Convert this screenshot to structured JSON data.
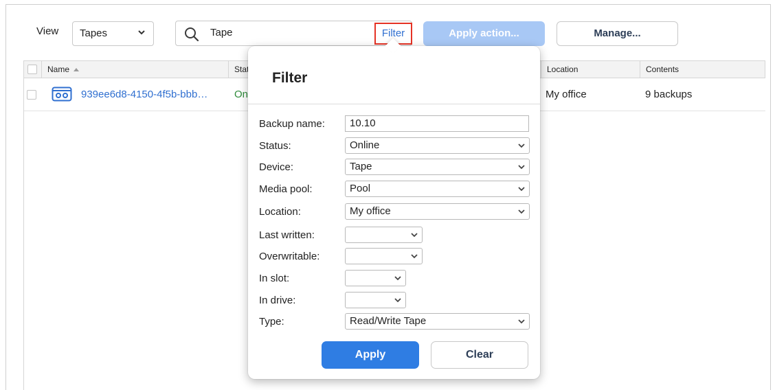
{
  "toolbar": {
    "view_label": "View",
    "view_value": "Tapes",
    "search_value": "Tape",
    "clear_glyph": "×",
    "filter_label": "Filter",
    "apply_action_label": "Apply action...",
    "manage_label": "Manage..."
  },
  "table": {
    "columns": [
      "Name",
      "Stat",
      "Location",
      "Contents"
    ],
    "rows": [
      {
        "name": "939ee6d8-4150-4f5b-bbb…",
        "status": "On",
        "location": "My office",
        "contents": "9 backups"
      }
    ]
  },
  "filter": {
    "title": "Filter",
    "fields": [
      {
        "label": "Backup name:",
        "value": "10.10"
      },
      {
        "label": "Status:",
        "value": "Online"
      },
      {
        "label": "Device:",
        "value": "Tape"
      },
      {
        "label": "Media pool:",
        "value": "Pool"
      },
      {
        "label": "Location:",
        "value": "My office"
      },
      {
        "label": "Last written:",
        "value": ""
      },
      {
        "label": "Overwritable:",
        "value": ""
      },
      {
        "label": "In slot:",
        "value": ""
      },
      {
        "label": "In drive:",
        "value": ""
      },
      {
        "label": "Type:",
        "value": "Read/Write Tape"
      }
    ],
    "apply_label": "Apply",
    "clear_label": "Clear"
  },
  "icons": {
    "search": "search-icon",
    "chevron": "chevron-down-icon",
    "tape": "tape-icon",
    "sort": "sort-ascending-icon"
  },
  "colors": {
    "accent": "#2f7de3",
    "link": "#2f6fd0",
    "online": "#2e8b3a",
    "highlight_border": "#e53224",
    "disabled_button": "#a8c8f5"
  }
}
